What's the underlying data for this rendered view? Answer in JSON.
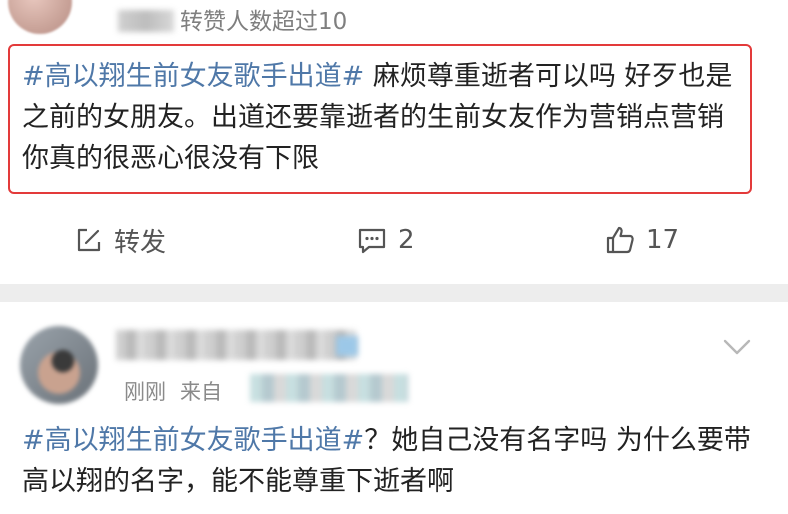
{
  "post1": {
    "repost_note": "转赞人数超过10",
    "hashtag": "#高以翔生前女友歌手出道#",
    "text": " 麻烦尊重逝者可以吗 好歹也是之前的女朋友。出道还要靠逝者的生前女友作为营销点营销 你真的很恶心很没有下限",
    "actions": {
      "repost_label": "转发",
      "comment_count": "2",
      "like_count": "17"
    }
  },
  "post2": {
    "time": "刚刚",
    "source_prefix": "来自",
    "hashtag": "#高以翔生前女友歌手出道#",
    "text": "？她自己没有名字吗 为什么要带高以翔的名字，能不能尊重下逝者啊"
  },
  "icons": {
    "repost": "edit-square-icon",
    "comment": "comment-bubble-icon",
    "like": "thumbs-up-icon",
    "more": "chevron-down-icon"
  },
  "colors": {
    "hashtag": "#4f78a8",
    "highlight_border": "#e33a3a",
    "muted_text": "#8a8a8a"
  }
}
